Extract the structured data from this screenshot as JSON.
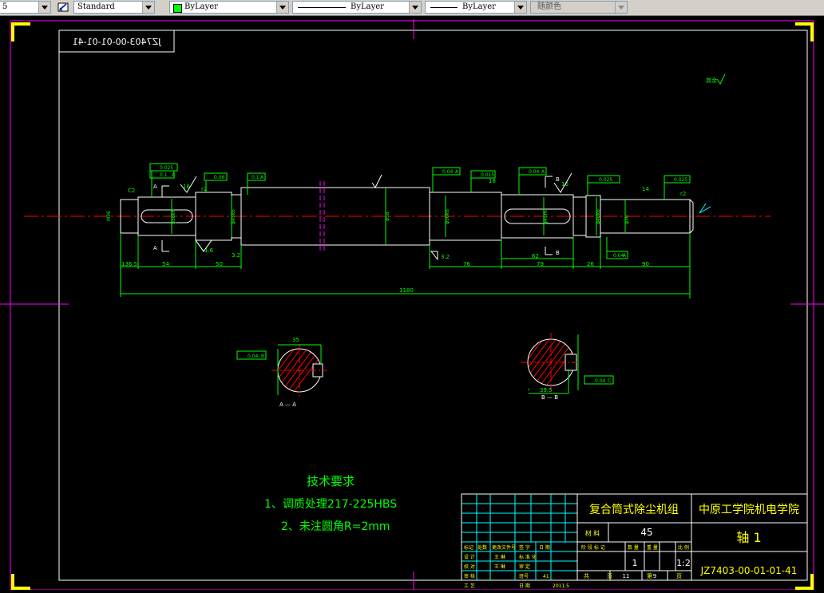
{
  "toolbar": {
    "left_combo": "5",
    "text_style": "Standard",
    "layer": "ByLayer",
    "linetype": "ByLayer",
    "lineweight": "ByLayer",
    "plot_style": "随颜色"
  },
  "drawing": {
    "mirror_id": "JZ7403-00-01-01-41",
    "other_roughness": "其余",
    "dimensions": {
      "d1": "136.5",
      "d2": "54",
      "d3": "50",
      "d4": "76",
      "d5": "62",
      "d6": "79",
      "d7": "26",
      "d8": "90",
      "total": "1180",
      "d16a": "16",
      "d16b": "16",
      "d18": "18",
      "d14": "14",
      "d16v": "1.6",
      "d32": "3.2",
      "d32b": "3.2",
      "sec_a_width": "35",
      "sec_b_width": "39.5",
      "c2": "C2",
      "r2": "r2"
    },
    "tolerances": {
      "t1": "0.025",
      "t2": "0.1",
      "t3": "0.06",
      "t4": "0.1",
      "t5": "0.04",
      "t6": "0.015",
      "t7": "0.04",
      "t8": "0.025",
      "t9": "0.025",
      "t10": "0.04",
      "t11": "0.025",
      "t12": "0.04",
      "t13": "0.04",
      "datum_a": "A",
      "datum_b": "B",
      "datum_c": "C"
    },
    "section_a_label": "A — A",
    "section_b_label": "B — B",
    "section_marker_a": "A",
    "section_marker_b": "B"
  },
  "notes": {
    "title": "技术要求",
    "line1": "1、调质处理217-225HBS",
    "line2": "2、未注圆角R=2mm"
  },
  "title_block": {
    "product": "复合筒式除尘机组",
    "school": "中原工学院机电学院",
    "material_label": "材  料",
    "material": "45",
    "part_name": "轴  1",
    "drawing_no": "JZ7403-00-01-01-41",
    "scale": "1:2",
    "count": "1",
    "sheet_total_label": "共",
    "sheet_total": "11",
    "sheet_total_unit": "页",
    "sheet_no_label": "第",
    "sheet_no": "9",
    "sheet_no_unit": "页",
    "headers": [
      "标记",
      "处数",
      "更改文件号",
      "签 字",
      "日 期"
    ],
    "mid_headers": [
      "阶 段 标 记",
      "数 量",
      "重 量",
      "比 例"
    ],
    "roles": [
      "设 计",
      "校 对",
      "审 核",
      "工 艺"
    ],
    "people": [
      "王 琳",
      "王 琳"
    ],
    "role_extra": [
      "标 准 化",
      "审 定"
    ],
    "class_label": "班号",
    "class_no": "41",
    "date_label": "日 期",
    "date": "2011.5"
  },
  "colors": {
    "border": "#ff00ff",
    "part": "#ffffff",
    "dims": "#00ff00",
    "center": "#ff0000",
    "corner": "#ffff00",
    "hatch": "#ff0000",
    "surface": "#00ffff"
  }
}
